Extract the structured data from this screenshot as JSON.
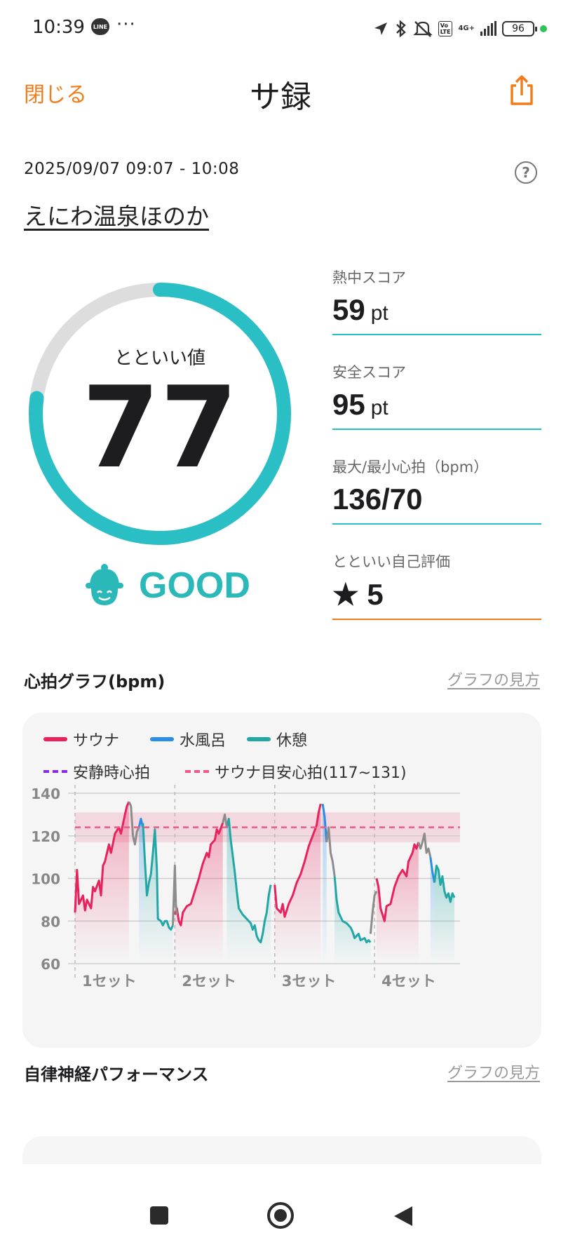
{
  "status_bar": {
    "time": "10:39",
    "line_icon": "LINE",
    "more": "···",
    "network": "4G+",
    "battery": "96",
    "icons": [
      "location-icon",
      "bluetooth-icon",
      "mute-icon",
      "volte-icon",
      "signal-icon",
      "battery-icon"
    ]
  },
  "header": {
    "close_label": "閉じる",
    "title": "サ録",
    "share_icon": "share-icon"
  },
  "session": {
    "datetime": "2025/09/07 09:07 - 10:08",
    "facility": "えにわ温泉ほのか",
    "help_icon": "?"
  },
  "gauge": {
    "label": "とといい値",
    "value": "77",
    "fraction": 0.77,
    "rating": "GOOD",
    "colors": {
      "fill": "#2abfc4",
      "track": "#dddddd"
    }
  },
  "stats": [
    {
      "label": "熱中スコア",
      "value": "59",
      "unit": "pt",
      "rule_color": "#2abfc4"
    },
    {
      "label": "安全スコア",
      "value": "95",
      "unit": "pt",
      "rule_color": "#2abfc4"
    },
    {
      "label": "最大/最小心拍（bpm）",
      "value": "136/70",
      "unit": "",
      "rule_color": "#2abfc4"
    },
    {
      "label": "とといい自己評価",
      "value": "★ 5",
      "unit": "",
      "rule_color": "#f07c1a"
    }
  ],
  "heart_section": {
    "title": "心拍グラフ(bpm)",
    "link": "グラフの見方"
  },
  "legend": {
    "sauna": "サウナ",
    "water": "水風呂",
    "rest": "休憩",
    "resting_hr": "安静時心拍",
    "target_hr": "サウナ目安心拍(117~131)"
  },
  "chart_data": {
    "type": "line",
    "y_ticks": [
      "140",
      "120",
      "100",
      "80",
      "60"
    ],
    "ylim": [
      60,
      140
    ],
    "target_band": [
      117,
      131
    ],
    "target_line": 124,
    "x_labels": [
      "1セット",
      "2セット",
      "3セット",
      "4セット"
    ],
    "colors": {
      "sauna": "#e8225c",
      "water": "#2a8de6",
      "rest": "#22a6a6",
      "other": "#8c8c8c",
      "target": "#ee5a86"
    },
    "series": [
      {
        "name": "サウナ",
        "segments": [
          [
            [
              0,
              84
            ],
            [
              1,
              104
            ],
            [
              2,
              88
            ],
            [
              4,
              92
            ],
            [
              5,
              85
            ],
            [
              6,
              90
            ],
            [
              8,
              86
            ],
            [
              9,
              96
            ],
            [
              10,
              94
            ],
            [
              12,
              99
            ],
            [
              13,
              92
            ],
            [
              14,
              106
            ],
            [
              15,
              108
            ],
            [
              17,
              116
            ],
            [
              18,
              112
            ],
            [
              20,
              121
            ],
            [
              22,
              124
            ],
            [
              23,
              121
            ],
            [
              25,
              130
            ],
            [
              26,
              134
            ],
            [
              27,
              136
            ]
          ],
          [
            [
              50,
              83
            ],
            [
              51,
              86
            ],
            [
              52,
              80
            ],
            [
              53,
              78
            ],
            [
              54,
              84
            ],
            [
              56,
              87
            ],
            [
              58,
              88
            ],
            [
              60,
              94
            ],
            [
              62,
              100
            ],
            [
              64,
              107
            ],
            [
              66,
              112
            ],
            [
              67,
              110
            ],
            [
              68,
              116
            ],
            [
              70,
              118
            ],
            [
              71,
              123
            ],
            [
              72,
              121
            ],
            [
              74,
              126
            ]
          ],
          [
            [
              100,
              97
            ],
            [
              101,
              86
            ],
            [
              103,
              84
            ],
            [
              104,
              88
            ],
            [
              105,
              82
            ],
            [
              107,
              88
            ],
            [
              109,
              92
            ],
            [
              111,
              98
            ],
            [
              113,
              102
            ],
            [
              115,
              108
            ],
            [
              117,
              115
            ],
            [
              119,
              120
            ],
            [
              121,
              125
            ],
            [
              122,
              131
            ],
            [
              123,
              135
            ]
          ],
          [
            [
              151,
              100
            ],
            [
              152,
              96
            ],
            [
              153,
              86
            ],
            [
              155,
              80
            ],
            [
              156,
              87
            ],
            [
              158,
              88
            ],
            [
              160,
              96
            ],
            [
              162,
              101
            ],
            [
              164,
              104
            ],
            [
              166,
              101
            ],
            [
              167,
              108
            ],
            [
              169,
              112
            ],
            [
              170,
              116
            ],
            [
              171,
              114
            ],
            [
              172,
              117
            ]
          ]
        ]
      },
      {
        "name": "水風呂",
        "segments": [
          [
            [
              32,
              124
            ],
            [
              33,
              128
            ],
            [
              34,
              124
            ]
          ],
          [
            [
              124,
              135
            ],
            [
              125,
              129
            ],
            [
              126,
              117
            ]
          ],
          [
            [
              178,
              110
            ],
            [
              179,
              103
            ],
            [
              180,
              98
            ]
          ]
        ]
      },
      {
        "name": "休憩",
        "segments": [
          [
            [
              34,
              126
            ],
            [
              35,
              108
            ],
            [
              36,
              92
            ],
            [
              37,
              98
            ],
            [
              38,
              102
            ],
            [
              39,
              112
            ],
            [
              40,
              123
            ],
            [
              41,
              104
            ],
            [
              41.5,
              81
            ],
            [
              43,
              80
            ],
            [
              44,
              78
            ],
            [
              45,
              80
            ],
            [
              46,
              80
            ],
            [
              47,
              77
            ],
            [
              48,
              76
            ],
            [
              49,
              78
            ]
          ],
          [
            [
              76,
              124
            ],
            [
              77,
              128
            ],
            [
              78,
              118
            ],
            [
              80,
              103
            ],
            [
              81,
              94
            ],
            [
              82,
              86
            ],
            [
              84,
              83
            ],
            [
              86,
              81
            ],
            [
              88,
              79
            ],
            [
              89,
              76
            ],
            [
              90,
              78
            ],
            [
              91,
              73
            ],
            [
              92,
              71
            ],
            [
              93,
              70
            ],
            [
              94,
              74
            ],
            [
              95,
              80
            ],
            [
              96,
              84
            ],
            [
              97,
              92
            ],
            [
              98,
              97
            ]
          ],
          [
            [
              130,
              101
            ],
            [
              131,
              90
            ],
            [
              132,
              84
            ],
            [
              134,
              80
            ],
            [
              136,
              79
            ],
            [
              138,
              77
            ],
            [
              139,
              75
            ],
            [
              140,
              72
            ],
            [
              142,
              74
            ],
            [
              143,
              71
            ],
            [
              145,
              72
            ],
            [
              146,
              70
            ],
            [
              147,
              71
            ],
            [
              148,
              70
            ]
          ],
          [
            [
              180,
              98
            ],
            [
              181,
              106
            ],
            [
              182,
              104
            ],
            [
              183,
              97
            ],
            [
              184,
              101
            ],
            [
              185,
              94
            ],
            [
              186,
              91
            ],
            [
              187,
              93
            ],
            [
              188,
              89
            ],
            [
              189,
              93
            ],
            [
              190,
              91
            ]
          ]
        ]
      },
      {
        "name": "その他",
        "segments": [
          [
            [
              27,
              136
            ],
            [
              28,
              134
            ],
            [
              29,
              120
            ],
            [
              30,
              116
            ],
            [
              31,
              122
            ],
            [
              32,
              124
            ]
          ],
          [
            [
              49,
              78
            ],
            [
              50,
              106
            ],
            [
              50.5,
              88
            ],
            [
              51,
              83
            ]
          ],
          [
            [
              74,
              126
            ],
            [
              75,
              130
            ],
            [
              76,
              124
            ]
          ],
          [
            [
              126,
              117
            ],
            [
              127,
              124
            ],
            [
              128,
              112
            ],
            [
              129,
              108
            ],
            [
              130,
              101
            ]
          ],
          [
            [
              148,
              74
            ],
            [
              149,
              84
            ],
            [
              150,
              92
            ],
            [
              151,
              94
            ]
          ],
          [
            [
              172,
              117
            ],
            [
              173,
              114
            ],
            [
              174,
              117
            ],
            [
              175,
              121
            ],
            [
              176,
              112
            ],
            [
              177,
              114
            ],
            [
              178,
              110
            ]
          ]
        ]
      }
    ],
    "x_max": 190,
    "set_starts": [
      0,
      50,
      100,
      150
    ]
  },
  "ans_section": {
    "title": "自律神経パフォーマンス",
    "link": "グラフの見方"
  },
  "navbar": {
    "icons": [
      "recent-apps-icon",
      "home-icon",
      "back-icon"
    ]
  }
}
